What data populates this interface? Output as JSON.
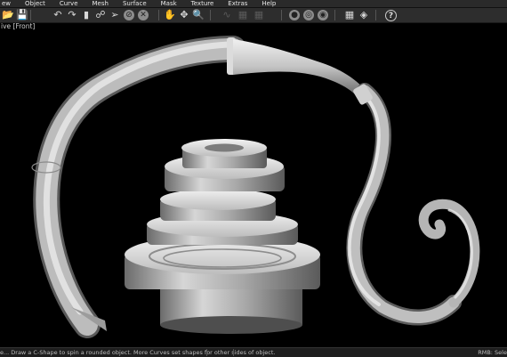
{
  "menubar": {
    "items": [
      "ew",
      "Object",
      "Curve",
      "Mesh",
      "Surface",
      "Mask",
      "Texture",
      "Extras",
      "Help"
    ]
  },
  "toolbar": {
    "icons": [
      "open-icon",
      "save-icon",
      "undo-icon",
      "redo-icon",
      "info-icon",
      "pan-icon",
      "select-icon",
      "no-entry-icon",
      "delete-icon",
      "hand-icon",
      "move-icon",
      "zoom-icon",
      "curve-tool-icon",
      "dim-tool-icon",
      "dim-tool-icon",
      "shade-icon",
      "shade-icon",
      "shade-icon",
      "grid-icon",
      "diamond-icon",
      "help-icon"
    ],
    "help_label": "?"
  },
  "viewport": {
    "title": "ive [Front]",
    "background": "#000000",
    "model_color": "#bdbdbd"
  },
  "status": {
    "left_text": "e... Draw a C-Shape to spin a rounded object. More Curves set shapes for other sides of object.",
    "right_text": "RMB: Sele"
  }
}
